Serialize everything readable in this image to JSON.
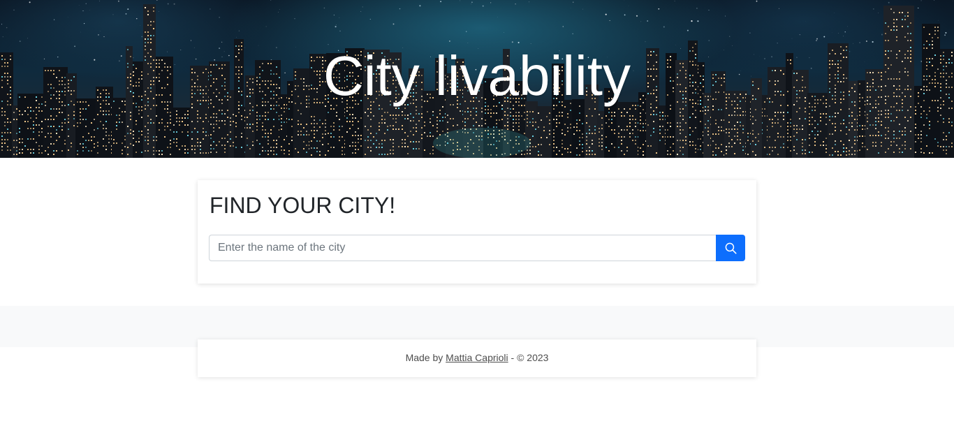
{
  "hero": {
    "title": "City livability"
  },
  "search": {
    "heading": "FIND YOUR CITY!",
    "placeholder": "Enter the name of the city",
    "button_icon": "search-icon"
  },
  "footer": {
    "prefix": "Made by",
    "author": "Mattia Caprioli",
    "suffix": "- © 2023"
  },
  "colors": {
    "accent": "#0d6efd",
    "band": "#f8f9fa",
    "text": "#212529"
  }
}
